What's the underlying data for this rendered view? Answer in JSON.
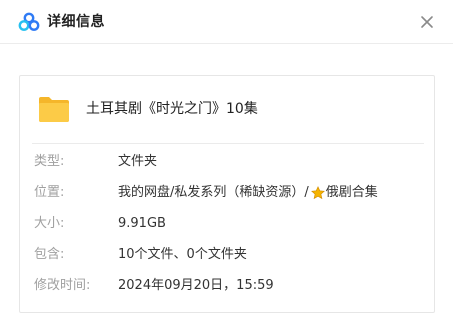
{
  "window": {
    "title": "详细信息",
    "logo_icon": "baidu-netdisk-logo-icon",
    "close_icon": "close-icon"
  },
  "file": {
    "name": "土耳其剧《时光之门》10集",
    "icon": "folder-icon"
  },
  "details": {
    "type": {
      "label": "类型:",
      "value": "文件夹"
    },
    "location": {
      "label": "位置:",
      "value_prefix": "我的网盘/私发系列（稀缺资源）/",
      "star_icon": "star-icon",
      "value_suffix": "俄剧合集"
    },
    "size": {
      "label": "大小:",
      "value": "9.91GB"
    },
    "contains": {
      "label": "包含:",
      "value": "10个文件、0个文件夹"
    },
    "modified": {
      "label": "修改时间:",
      "value": "2024年09月20日，15:59"
    }
  },
  "colors": {
    "folder": "#F9C23C",
    "label_gray": "#A0A0A0",
    "logo_blue": "#2F7BF5",
    "logo_cyan": "#26C0F0",
    "star": "#F5B400"
  }
}
